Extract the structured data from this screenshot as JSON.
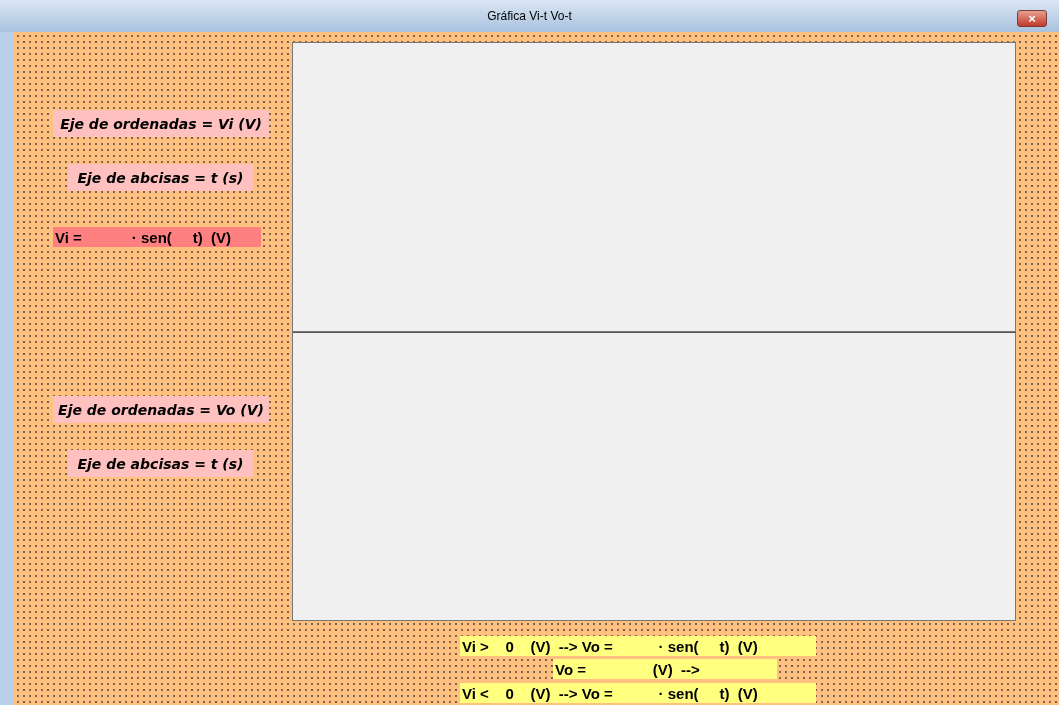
{
  "window": {
    "title": "Gráfica Vi-t Vo-t",
    "close_button": "×"
  },
  "labels": [
    {
      "text": "Eje de ordenadas = Vi (V)",
      "kind": "axis",
      "color": "#ffc0c0"
    },
    {
      "text": "Eje de abcisas = t (s)",
      "kind": "axis",
      "color": "#ffc0c0"
    },
    {
      "text": "Vi =            · sen(     t)  (V)",
      "kind": "equation",
      "color": "#ff8080"
    },
    {
      "text": "Eje de ordenadas = Vo (V)",
      "kind": "axis",
      "color": "#ffc0c0"
    },
    {
      "text": "Eje de abcisas = t (s)",
      "kind": "axis",
      "color": "#ffc0c0"
    },
    {
      "text": "Vi >    0    (V)  --> Vo =           · sen(     t)  (V)",
      "kind": "equation",
      "color": "#ffff80"
    },
    {
      "text": "Vo =                (V)  -->",
      "kind": "equation",
      "color": "#ffff80"
    },
    {
      "text": "Vi <    0    (V)  --> Vo =           · sen(     t)  (V)",
      "kind": "equation",
      "color": "#ffff80"
    }
  ],
  "panels": [
    {
      "kind": "image"
    },
    {
      "kind": "image"
    }
  ]
}
